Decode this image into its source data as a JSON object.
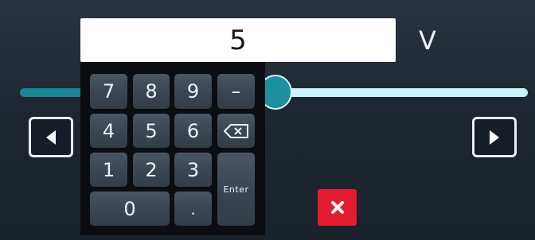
{
  "entry": {
    "value": "5",
    "unit": "V"
  },
  "slider": {
    "level_fraction": 0.53
  },
  "keypad": {
    "keys": {
      "k7": "7",
      "k8": "8",
      "k9": "9",
      "minus": "–",
      "k4": "4",
      "k5": "5",
      "k6": "6",
      "k1": "1",
      "k2": "2",
      "k3": "3",
      "enter": "Enter",
      "k0": "0",
      "dot": "."
    },
    "backspace_icon": "backspace-icon"
  },
  "buttons": {
    "left_icon": "triangle-left-icon",
    "right_icon": "triangle-right-icon",
    "close_icon": "close-icon"
  },
  "colors": {
    "track_filled": "#1a8597",
    "track_empty": "#c8f4fb",
    "close_red": "#e21c2e"
  }
}
